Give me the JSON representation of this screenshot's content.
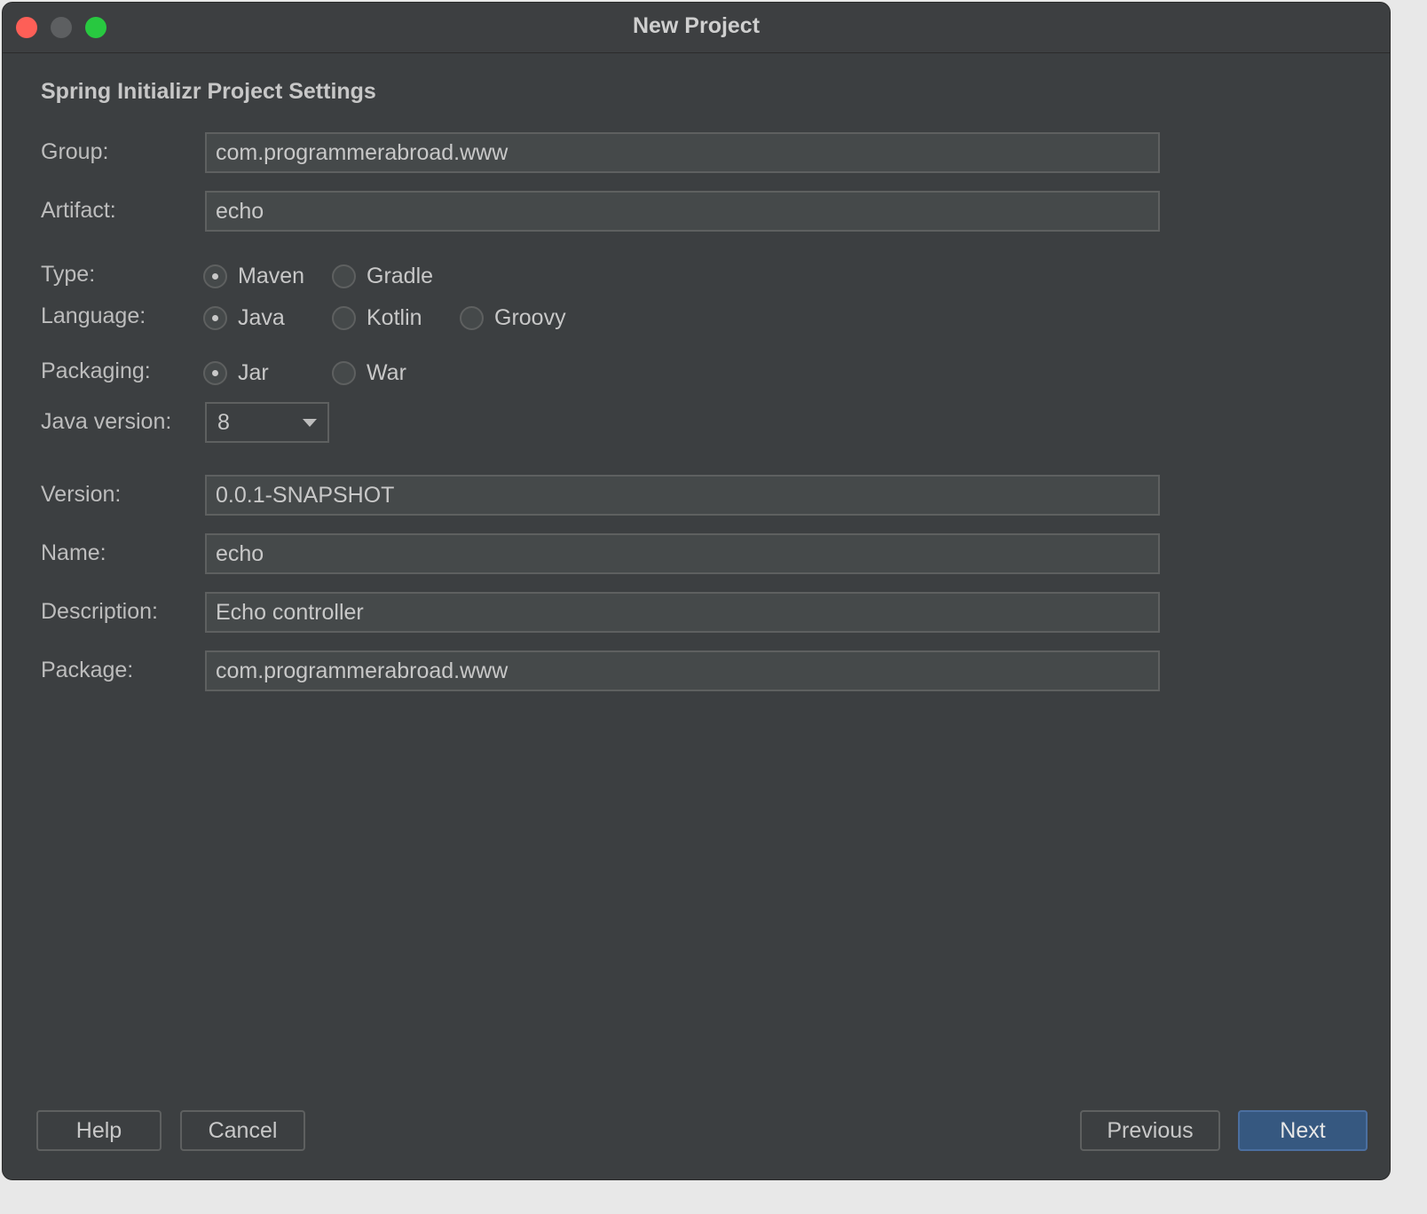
{
  "window": {
    "title": "New Project"
  },
  "section_title": "Spring Initializr Project Settings",
  "group": {
    "label": "Group:",
    "value": "com.programmerabroad.www"
  },
  "artifact": {
    "label": "Artifact:",
    "value": "echo"
  },
  "type": {
    "label": "Type:",
    "options": [
      "Maven",
      "Gradle"
    ],
    "selected": "Maven"
  },
  "language": {
    "label": "Language:",
    "options": [
      "Java",
      "Kotlin",
      "Groovy"
    ],
    "selected": "Java"
  },
  "packaging": {
    "label": "Packaging:",
    "options": [
      "Jar",
      "War"
    ],
    "selected": "Jar"
  },
  "java_version": {
    "label": "Java version:",
    "value": "8"
  },
  "version": {
    "label": "Version:",
    "value": "0.0.1-SNAPSHOT"
  },
  "name": {
    "label": "Name:",
    "value": "echo"
  },
  "description": {
    "label": "Description:",
    "value": "Echo controller"
  },
  "package": {
    "label": "Package:",
    "value": "com.programmerabroad.www"
  },
  "buttons": {
    "help": "Help",
    "cancel": "Cancel",
    "previous": "Previous",
    "next": "Next"
  }
}
